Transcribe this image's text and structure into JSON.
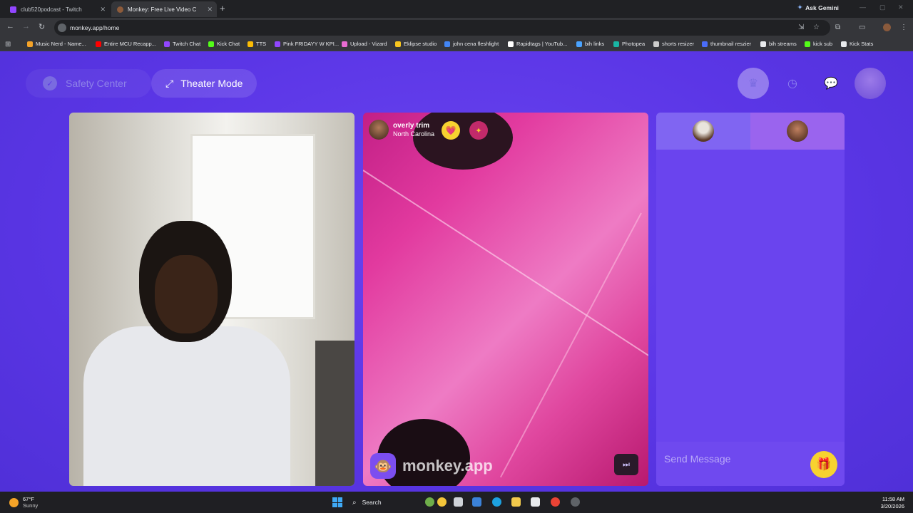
{
  "browser": {
    "tabs": [
      {
        "title": "club520podcast - Twitch",
        "active": false,
        "favicon_color": "#9146ff"
      },
      {
        "title": "Monkey: Free Live Video Ch",
        "active": true,
        "favicon_color": "#8d5b3a"
      }
    ],
    "new_tab": "+",
    "ask_gemini": "Ask Gemini",
    "url": "monkey.app/home",
    "bookmarks": [
      {
        "label": "Music Nerd - Name...",
        "color": "#f4a328"
      },
      {
        "label": "Entire MCU Recapp...",
        "color": "#ff0000"
      },
      {
        "label": "Twitch Chat",
        "color": "#9146ff"
      },
      {
        "label": "Kick Chat",
        "color": "#53fc18"
      },
      {
        "label": "TTS",
        "color": "#fbbc05"
      },
      {
        "label": "Pink FRIDAYY W KPI...",
        "color": "#9146ff"
      },
      {
        "label": "Upload - Vizard",
        "color": "#e86bd1"
      },
      {
        "label": "Eklipse studio",
        "color": "#f7c51e"
      },
      {
        "label": "john cena fleshlight",
        "color": "#4285f4"
      },
      {
        "label": "Rapidtags | YouTub...",
        "color": "#ffffff"
      },
      {
        "label": "bih links",
        "color": "#4aa3ff"
      },
      {
        "label": "Photopea",
        "color": "#19b5a5"
      },
      {
        "label": "shorts resizer",
        "color": "#cccccc"
      },
      {
        "label": "thumbnail reszier",
        "color": "#4a6cf7"
      },
      {
        "label": "bih streams",
        "color": "#e8eaed"
      },
      {
        "label": "kick sub",
        "color": "#53fc18"
      },
      {
        "label": "Kick Stats",
        "color": "#e8eaed"
      }
    ]
  },
  "app": {
    "safety_center": "Safety Center",
    "theater_mode": "Theater Mode",
    "icons": {
      "crown": "crown-icon",
      "history": "clock-icon",
      "chat": "chat-bubble-icon",
      "profile": "avatar"
    },
    "peer": {
      "name": "overly trim",
      "location": "North Carolina"
    },
    "watermark": "monkey.app",
    "chat": {
      "send_placeholder": "Send Message"
    },
    "colors": {
      "background": "#5b36e6",
      "accent_yellow": "#f7d230",
      "panel": "#6a44ee"
    }
  },
  "taskbar": {
    "weather_temp": "67°F",
    "weather_desc": "Sunny",
    "search": "Search",
    "time": "11:58 AM",
    "date": "3/20/2026"
  }
}
